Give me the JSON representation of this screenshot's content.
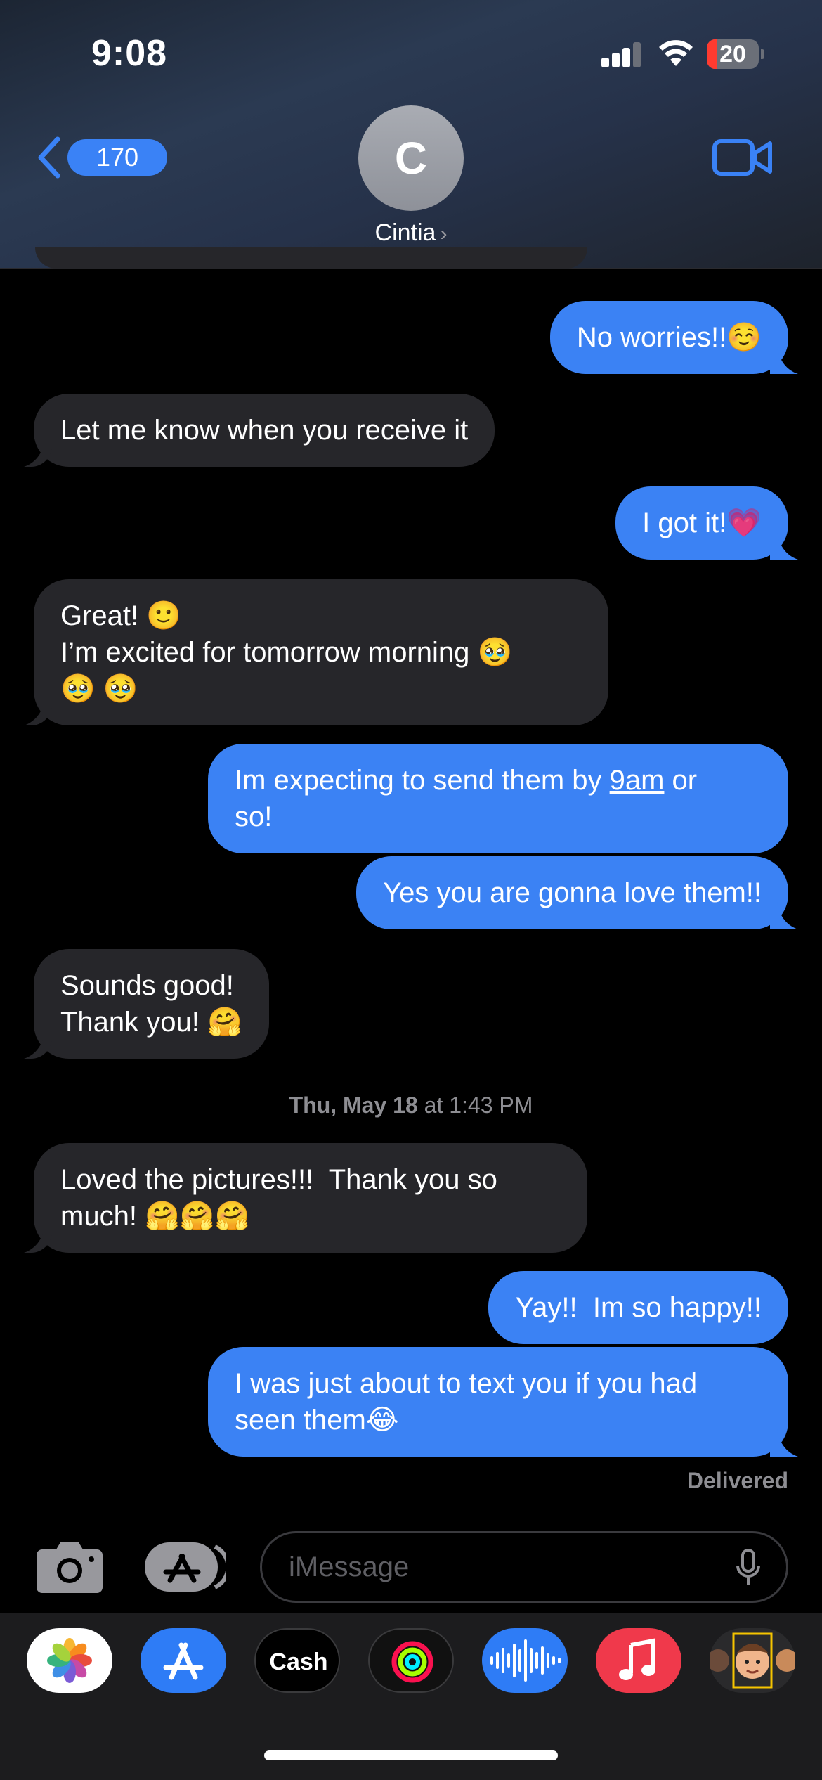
{
  "status_bar": {
    "time": "9:08",
    "battery": "20",
    "battery_level_percent": 20
  },
  "header": {
    "back_count": "170",
    "avatar_initial": "C",
    "contact_name": "Cintia",
    "video_icon": "video-camera-icon"
  },
  "messages": [
    {
      "from": "me",
      "text": "No worries!!☺️"
    },
    {
      "from": "them",
      "text": "Let me know when you receive it"
    },
    {
      "from": "me",
      "text": "I got it!💗"
    },
    {
      "from": "them",
      "text": "Great! 🙂\nI’m excited for tomorrow morning 🥹\n🥹 🥹"
    },
    {
      "from": "me",
      "text_before": "Im expecting to send them by ",
      "link": "9am",
      "text_after": " or\nso!"
    },
    {
      "from": "me",
      "text": "Yes you are gonna love them!!"
    },
    {
      "from": "them",
      "text": "Sounds good!\nThank you! 🤗"
    },
    {
      "from": "them",
      "text": "Loved the pictures!!!  Thank you so\nmuch! 🤗🤗🤗"
    },
    {
      "from": "me",
      "text": "Yay!!  Im so happy!!"
    },
    {
      "from": "me",
      "text": "I was just about to text you if you had\nseen them😂"
    }
  ],
  "timestamp": {
    "day": "Thu, May 18",
    "time": " at 1:43 PM"
  },
  "delivered": "Delivered",
  "composer": {
    "placeholder": "iMessage",
    "camera_icon": "camera-icon",
    "apps_icon": "app-store-icon",
    "mic_icon": "microphone-icon"
  },
  "app_drawer": {
    "apps": [
      "Photos",
      "App Store",
      "Cash",
      "Fitness",
      "Audio",
      "Music",
      "Memoji"
    ],
    "cash_label": "Cash"
  }
}
